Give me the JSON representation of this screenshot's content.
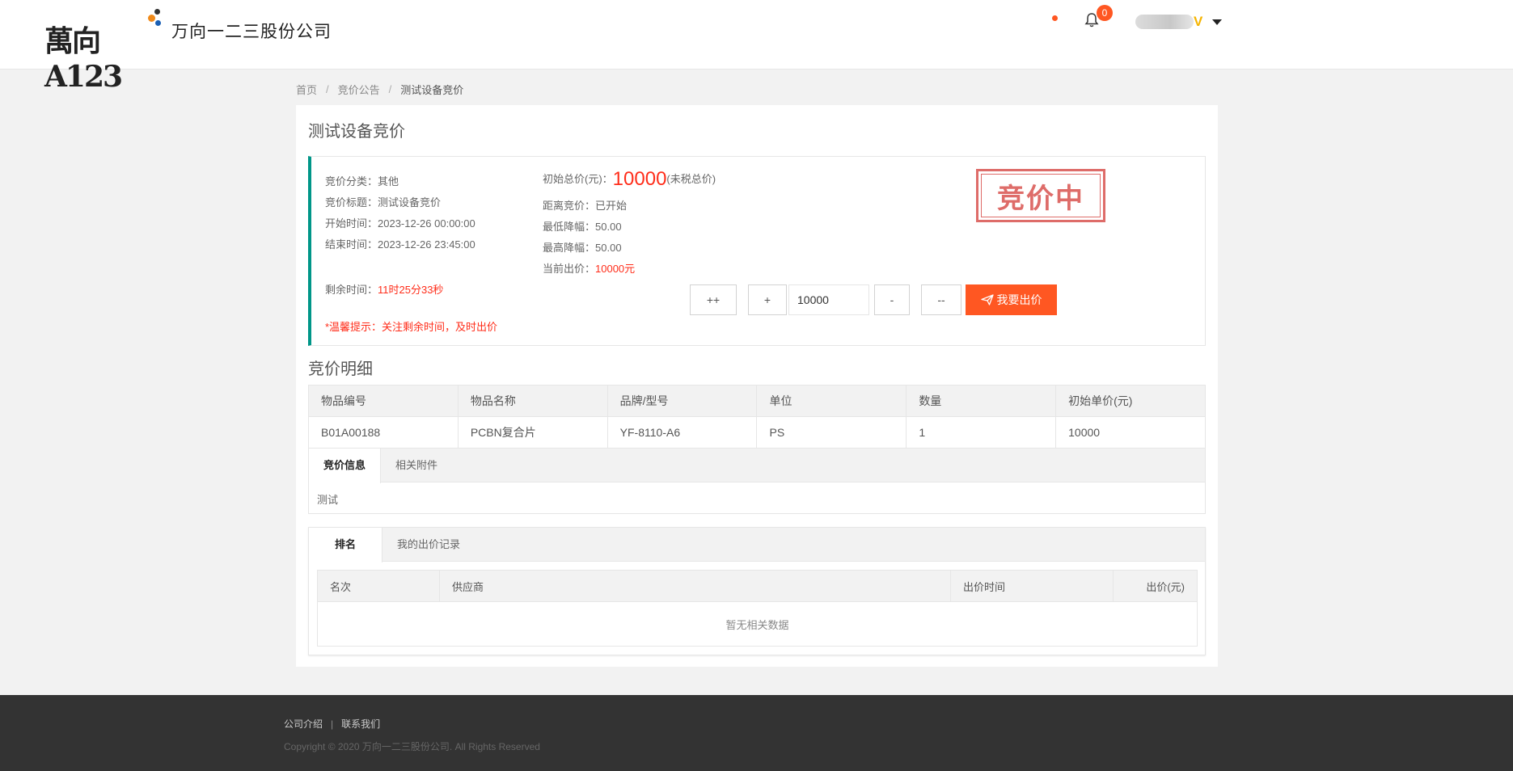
{
  "header": {
    "logo_text": "萬向A123",
    "company_name": "万向一二三股份公司",
    "notification_count": "0",
    "user_vip": "V"
  },
  "breadcrumb": {
    "home": "首页",
    "sep1": "/",
    "section": "竞价公告",
    "sep2": "/",
    "current": "测试设备竞价"
  },
  "page": {
    "title": "测试设备竞价"
  },
  "info": {
    "category_label": "竞价分类：",
    "category_value": "其他",
    "bid_title_label": "竞价标题：",
    "bid_title_value": "测试设备竞价",
    "start_label": "开始时间：",
    "start_value": "2023-12-26 00:00:00",
    "end_label": "结束时间：",
    "end_value": "2023-12-26 23:45:00",
    "remaining_label": "剩余时间：",
    "remaining_value": "11时25分33秒",
    "tip": "*温馨提示：关注剩余时间，及时出价",
    "initial_total_label": "初始总价(元)：",
    "initial_total_value": "10000",
    "initial_total_suffix": "(未税总价)",
    "distance_label": "距离竞价：",
    "distance_value": "已开始",
    "min_drop_label": "最低降幅：",
    "min_drop_value": "50.00",
    "max_drop_label": "最高降幅：",
    "max_drop_value": "50.00",
    "current_bid_label": "当前出价：",
    "current_bid_value": "10000元",
    "stamp": "竞价中"
  },
  "bid": {
    "plus_plus": "++",
    "plus": "+",
    "value": "10000",
    "minus": "-",
    "minus_minus": "--",
    "submit": "我要出价"
  },
  "detail": {
    "title": "竞价明细",
    "columns": [
      "物品编号",
      "物品名称",
      "品牌/型号",
      "单位",
      "数量",
      "初始单价(元)"
    ],
    "rows": [
      [
        "B01A00188",
        "PCBN复合片",
        "YF-8110-A6",
        "PS",
        "1",
        "10000"
      ]
    ]
  },
  "info_tabs": {
    "tabs": [
      "竞价信息",
      "相关附件"
    ],
    "content": "测试"
  },
  "rank_tabs": {
    "tabs": [
      "排名",
      "我的出价记录"
    ],
    "columns": [
      "名次",
      "供应商",
      "出价时间",
      "出价(元)"
    ],
    "empty": "暂无相关数据"
  },
  "footer": {
    "link_about": "公司介绍",
    "divider": "|",
    "link_contact": "联系我们",
    "copyright": "Copyright © 2020 万向一二三股份公司. All Rights Reserved"
  },
  "colors": {
    "accent": "#ff5722",
    "teal": "#009688",
    "price_red": "#ff2d1a"
  }
}
